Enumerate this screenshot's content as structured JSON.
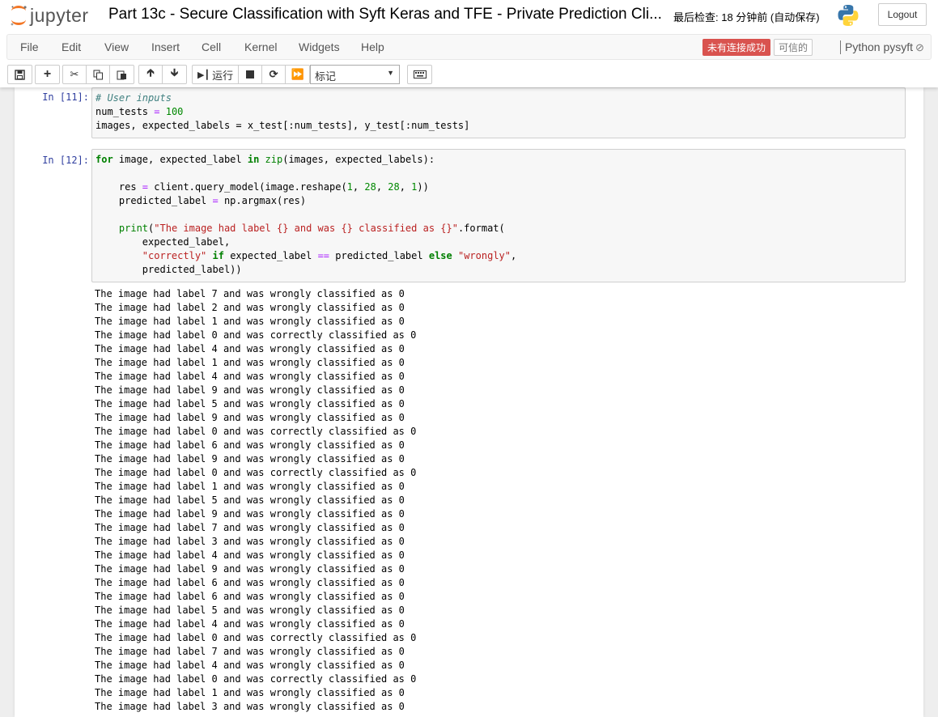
{
  "header": {
    "logo_text": "jupyter",
    "notebook_title": "Part 13c - Secure Classification with Syft Keras and TFE - Private Prediction Cli...",
    "checkpoint": "最后检查: 18 分钟前  (自动保存)",
    "logout_label": "Logout"
  },
  "menu": {
    "items": [
      "File",
      "Edit",
      "View",
      "Insert",
      "Cell",
      "Kernel",
      "Widgets",
      "Help"
    ],
    "kernel_status": "未有连接成功",
    "trusted": "可信的",
    "kernel_name": "Python pysyft"
  },
  "toolbar": {
    "run_label": "运行",
    "cell_type": "标记"
  },
  "cells": {
    "c11": {
      "prompt": "In  [11]:",
      "lines": [
        "# User inputs",
        "num_tests = 100",
        "images, expected_labels = x_test[:num_tests], y_test[:num_tests]"
      ]
    },
    "c12": {
      "prompt": "In  [12]:",
      "lines": [
        "for image, expected_label in zip(images, expected_labels):",
        "",
        "    res = client.query_model(image.reshape(1, 28, 28, 1))",
        "    predicted_label = np.argmax(res)",
        "",
        "    print(\"The image had label {} and was {} classified as {}\".format(",
        "        expected_label,",
        "        \"correctly\" if expected_label == predicted_label else \"wrongly\",",
        "        predicted_label))"
      ],
      "output": [
        "The image had label 7 and was wrongly classified as 0",
        "The image had label 2 and was wrongly classified as 0",
        "The image had label 1 and was wrongly classified as 0",
        "The image had label 0 and was correctly classified as 0",
        "The image had label 4 and was wrongly classified as 0",
        "The image had label 1 and was wrongly classified as 0",
        "The image had label 4 and was wrongly classified as 0",
        "The image had label 9 and was wrongly classified as 0",
        "The image had label 5 and was wrongly classified as 0",
        "The image had label 9 and was wrongly classified as 0",
        "The image had label 0 and was correctly classified as 0",
        "The image had label 6 and was wrongly classified as 0",
        "The image had label 9 and was wrongly classified as 0",
        "The image had label 0 and was correctly classified as 0",
        "The image had label 1 and was wrongly classified as 0",
        "The image had label 5 and was wrongly classified as 0",
        "The image had label 9 and was wrongly classified as 0",
        "The image had label 7 and was wrongly classified as 0",
        "The image had label 3 and was wrongly classified as 0",
        "The image had label 4 and was wrongly classified as 0",
        "The image had label 9 and was wrongly classified as 0",
        "The image had label 6 and was wrongly classified as 0",
        "The image had label 6 and was wrongly classified as 0",
        "The image had label 5 and was wrongly classified as 0",
        "The image had label 4 and was wrongly classified as 0",
        "The image had label 0 and was correctly classified as 0",
        "The image had label 7 and was wrongly classified as 0",
        "The image had label 4 and was wrongly classified as 0",
        "The image had label 0 and was correctly classified as 0",
        "The image had label 1 and was wrongly classified as 0",
        "The image had label 3 and was wrongly classified as 0"
      ]
    }
  },
  "colors": {
    "kernel_status_bg": "#d9534f",
    "prompt": "#303f9f"
  }
}
